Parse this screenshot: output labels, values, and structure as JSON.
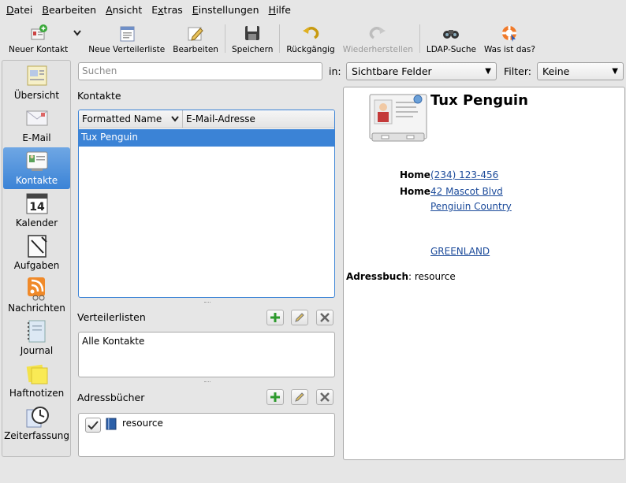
{
  "menubar": {
    "items": [
      {
        "ul": "D",
        "rest": "atei"
      },
      {
        "ul": "B",
        "rest": "earbeiten"
      },
      {
        "ul": "A",
        "rest": "nsicht"
      },
      {
        "ul": "",
        "pre": "E",
        "ul2": "x",
        "rest": "tras"
      },
      {
        "ul": "E",
        "rest": "instellungen"
      },
      {
        "ul": "H",
        "rest": "ilfe"
      }
    ]
  },
  "toolbar": {
    "new_contact": "Neuer Kontakt",
    "new_distlist": "Neue Verteilerliste",
    "edit": "Bearbeiten",
    "save": "Speichern",
    "undo": "Rückgängig",
    "redo": "Wiederherstellen",
    "ldap": "LDAP-Suche",
    "whats_this": "Was ist das?"
  },
  "sidebar": {
    "items": [
      {
        "label": "Übersicht",
        "icon": "overview-icon"
      },
      {
        "label": "E-Mail",
        "icon": "mail-icon"
      },
      {
        "label": "Kontakte",
        "icon": "contacts-icon",
        "active": true
      },
      {
        "label": "Kalender",
        "icon": "calendar-icon",
        "day": "14"
      },
      {
        "label": "Aufgaben",
        "icon": "tasks-icon"
      },
      {
        "label": "Nachrichten",
        "icon": "feeds-icon"
      },
      {
        "label": "Journal",
        "icon": "journal-icon"
      },
      {
        "label": "Haftnotizen",
        "icon": "notes-icon"
      },
      {
        "label": "Zeiterfassung",
        "icon": "timetracker-icon"
      }
    ]
  },
  "search": {
    "placeholder": "Suchen"
  },
  "in_label": "in:",
  "in_value": "Sichtbare Felder",
  "filter_label": "Filter:",
  "filter_value": "Keine",
  "contacts": {
    "title": "Kontakte",
    "columns": [
      "Formatted Name",
      "E-Mail-Adresse"
    ],
    "rows": [
      "Tux Penguin"
    ]
  },
  "distlists": {
    "title": "Verteilerlisten",
    "items": [
      "Alle Kontakte"
    ]
  },
  "addressbooks": {
    "title": "Adressbücher",
    "items": [
      "resource"
    ]
  },
  "detail": {
    "name": "Tux Penguin",
    "phone_label": "Home",
    "phone": "(234) 123-456",
    "address_label": "Home",
    "address_line1": "42 Mascot Blvd",
    "address_line2": "Pengiuin Country",
    "address_country": "GREENLAND",
    "addressbook_label": "Adressbuch",
    "addressbook_value": ": resource"
  },
  "colors": {
    "accent": "#3b83d6",
    "link": "#1b4a9a"
  }
}
